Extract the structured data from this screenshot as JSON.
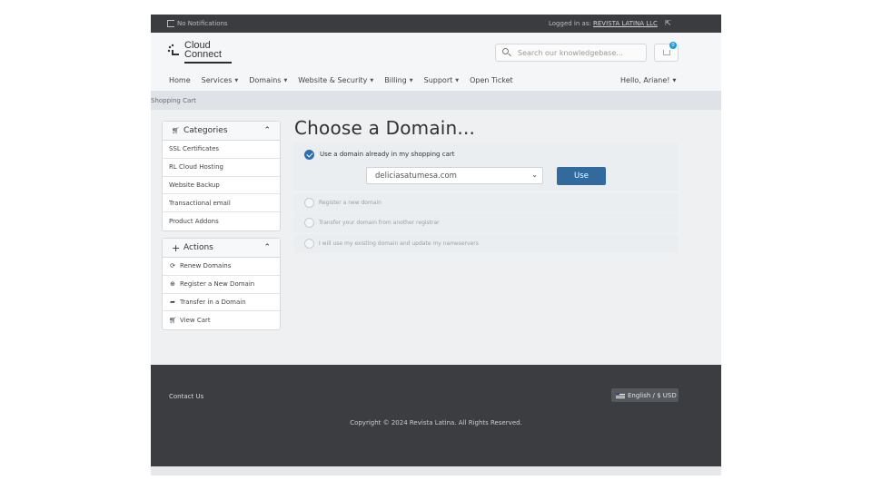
{
  "topbar": {
    "notifications": "No Notifications",
    "logged_in_as": "Logged in as:",
    "company": "REVISTA LATINA LLC"
  },
  "header": {
    "logo_line1": "Cloud",
    "logo_line2": "Connect",
    "search_placeholder": "Search our knowledgebase...",
    "cart_count": "0"
  },
  "nav": {
    "items": [
      {
        "label": "Home",
        "caret": false
      },
      {
        "label": "Services",
        "caret": true
      },
      {
        "label": "Domains",
        "caret": true
      },
      {
        "label": "Website & Security",
        "caret": true
      },
      {
        "label": "Billing",
        "caret": true
      },
      {
        "label": "Support",
        "caret": true
      },
      {
        "label": "Open Ticket",
        "caret": false
      }
    ],
    "greeting": "Hello, Ariane!"
  },
  "breadcrumb": "Shopping Cart",
  "sidebar": {
    "categories": {
      "title": "Categories",
      "items": [
        "SSL Certificates",
        "RL Cloud Hosting",
        "Website Backup",
        "Transactional email",
        "Product Addons"
      ]
    },
    "actions": {
      "title": "Actions",
      "items": [
        {
          "label": "Renew Domains",
          "icon": "refresh-icon"
        },
        {
          "label": "Register a New Domain",
          "icon": "globe-icon"
        },
        {
          "label": "Transfer in a Domain",
          "icon": "share-icon"
        },
        {
          "label": "View Cart",
          "icon": "cart-icon"
        }
      ]
    }
  },
  "main": {
    "title": "Choose a Domain...",
    "use_existing_label": "Use a domain already in my shopping cart",
    "selected_domain": "deliciasatumesa.com",
    "use_button": "Use",
    "register_new": "Register a new domain",
    "transfer": "Transfer your domain from another registrar",
    "existing_ns": "I will use my existing domain and update my nameservers"
  },
  "footer": {
    "contact": "Contact Us",
    "language": "English / $ USD",
    "copyright": "Copyright © 2024 Revista Latina. All Rights Reserved."
  },
  "colors": {
    "topbar": "#3a3c3f",
    "primary_button": "#336a9e",
    "checked": "#2f6fb0",
    "footer": "#3b3d40"
  }
}
